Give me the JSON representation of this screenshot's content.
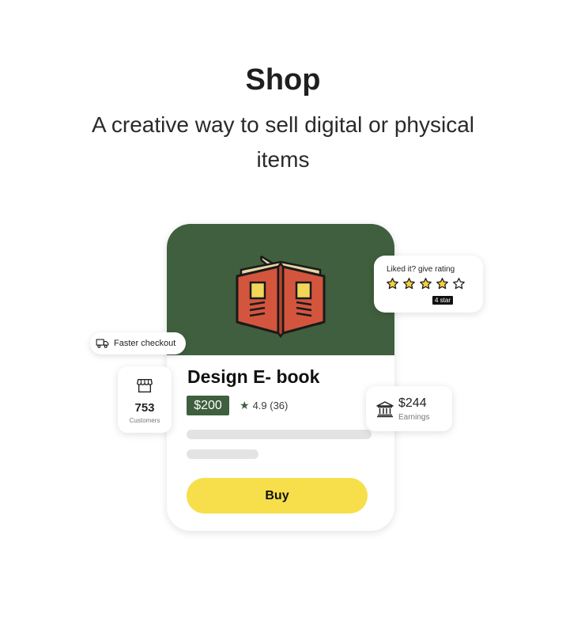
{
  "header": {
    "title": "Shop",
    "subtitle": "A creative way to sell digital or physical items"
  },
  "product": {
    "name": "Design E- book",
    "price": "$200",
    "rating_text": "4.9 (36)",
    "buy_label": "Buy",
    "icon": "open-book-icon"
  },
  "rating_popup": {
    "label": "Liked it? give rating",
    "stars_total": 5,
    "stars_selected": 4,
    "tooltip": "4 star"
  },
  "checkout": {
    "label": "Faster checkout",
    "icon": "truck-icon"
  },
  "customers": {
    "count": "753",
    "label": "Customers",
    "icon": "store-icon"
  },
  "earnings": {
    "amount": "$244",
    "label": "Earnings",
    "icon": "bank-icon"
  },
  "colors": {
    "brand_green": "#3f5f3e",
    "accent_yellow": "#f7df4c",
    "book_red": "#d4553e",
    "skeleton_gray": "#e3e3e3"
  }
}
